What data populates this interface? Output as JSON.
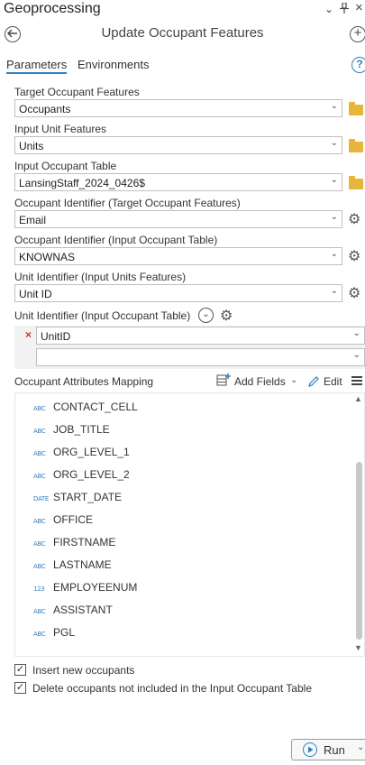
{
  "pane": {
    "title": "Geoprocessing",
    "pin_glyph": "⊥",
    "close_glyph": "×"
  },
  "tool": {
    "title": "Update Occupant Features"
  },
  "tabs": [
    {
      "label": "Parameters",
      "active": true
    },
    {
      "label": "Environments",
      "active": false
    }
  ],
  "params": {
    "target_occupant_features": {
      "label": "Target Occupant Features",
      "value": "Occupants"
    },
    "input_unit_features": {
      "label": "Input Unit Features",
      "value": "Units"
    },
    "input_occupant_table": {
      "label": "Input Occupant Table",
      "value": "LansingStaff_2024_0426$"
    },
    "occupant_id_target": {
      "label": "Occupant Identifier (Target Occupant Features)",
      "value": "Email"
    },
    "occupant_id_input": {
      "label": "Occupant Identifier (Input Occupant Table)",
      "value": "KNOWNAS"
    },
    "unit_id_input_units": {
      "label": "Unit Identifier (Input Units Features)",
      "value": "Unit ID"
    },
    "unit_id_input_occupant": {
      "label": "Unit Identifier (Input Occupant Table)",
      "value": "UnitID",
      "empty_value": ""
    }
  },
  "mapping": {
    "label": "Occupant Attributes Mapping",
    "add_fields_label": "Add Fields",
    "edit_label": "Edit",
    "items": [
      {
        "name": "CONTACT_CELL",
        "type_glyph": "ABC"
      },
      {
        "name": "JOB_TITLE",
        "type_glyph": "ABC"
      },
      {
        "name": "ORG_LEVEL_1",
        "type_glyph": "ABC"
      },
      {
        "name": "ORG_LEVEL_2",
        "type_glyph": "ABC"
      },
      {
        "name": "START_DATE",
        "type_glyph": "DATE"
      },
      {
        "name": "OFFICE",
        "type_glyph": "ABC"
      },
      {
        "name": "FIRSTNAME",
        "type_glyph": "ABC"
      },
      {
        "name": "LASTNAME",
        "type_glyph": "ABC"
      },
      {
        "name": "EMPLOYEENUM",
        "type_glyph": "123"
      },
      {
        "name": "ASSISTANT",
        "type_glyph": "ABC"
      },
      {
        "name": "PGL",
        "type_glyph": "ABC"
      }
    ]
  },
  "options": {
    "insert_new_occupants": {
      "label": "Insert new occupants",
      "checked": true
    },
    "delete_occupants": {
      "label": "Delete occupants not included in the Input Occupant Table",
      "checked": true
    }
  },
  "run": {
    "label": "Run"
  },
  "colors": {
    "accent": "#2f7fc1",
    "folder": "#e7b53a",
    "remove": "#c0392b"
  }
}
